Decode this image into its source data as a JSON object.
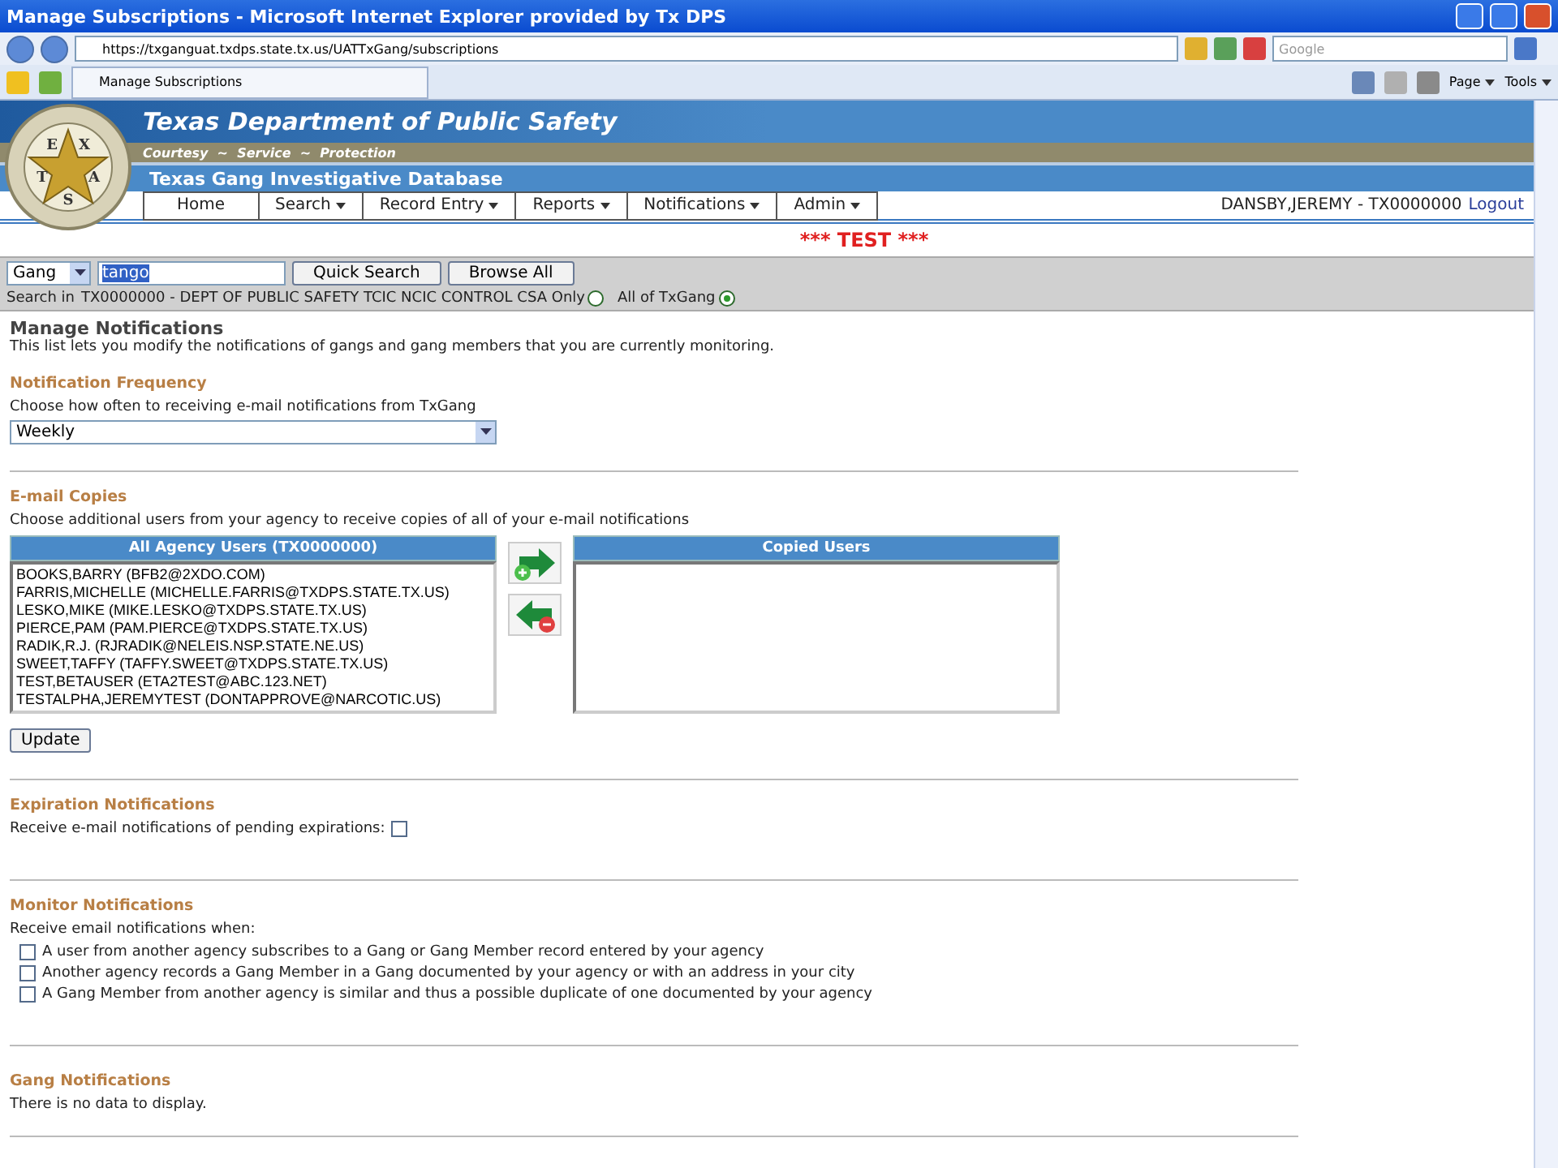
{
  "browser": {
    "title": "Manage Subscriptions - Microsoft Internet Explorer provided by Tx DPS",
    "address": "https://txganguat.txdps.state.tx.us/UATTxGang/subscriptions",
    "search_placeholder": "Google",
    "tab": "Manage Subscriptions",
    "tools": [
      "Page",
      "Tools"
    ]
  },
  "header": {
    "seal_letters": [
      "E",
      "X",
      "T",
      "A",
      "S"
    ],
    "title": "Texas Department of Public Safety",
    "motto": "Courtesy  ~  Service  ~  Protection",
    "subtitle": "Texas Gang Investigative Database",
    "nav": [
      {
        "label": "Home",
        "has_menu": false
      },
      {
        "label": "Search",
        "has_menu": true
      },
      {
        "label": "Record Entry",
        "has_menu": true
      },
      {
        "label": "Reports",
        "has_menu": true
      },
      {
        "label": "Notifications",
        "has_menu": true
      },
      {
        "label": "Admin",
        "has_menu": true
      }
    ],
    "user": "DANSBY,JEREMY - TX0000000",
    "logout": "Logout",
    "banner": "*** TEST ***"
  },
  "search": {
    "type": "Gang",
    "query": "tango",
    "buttons": [
      "Quick Search",
      "Browse All"
    ],
    "scope_label": "Search in",
    "scopes": [
      {
        "label": "TX0000000 - DEPT OF PUBLIC SAFETY TCIC NCIC CONTROL CSA Only",
        "selected": false
      },
      {
        "label": "All of TxGang",
        "selected": true
      }
    ]
  },
  "page": {
    "title": "Manage Notifications",
    "intro": "This list lets you modify the notifications of gangs and gang members that you are currently monitoring."
  },
  "frequency": {
    "title": "Notification Frequency",
    "label": "Choose how often to receiving e-mail notifications from TxGang",
    "value": "Weekly"
  },
  "copies": {
    "title": "E-mail Copies",
    "label": "Choose additional users from your agency to receive copies of all of your e-mail notifications",
    "all_header": "All Agency Users (TX0000000)",
    "copied_header": "Copied Users",
    "all_users": [
      "BOOKS,BARRY (BFB2@2XDO.COM)",
      "FARRIS,MICHELLE (MICHELLE.FARRIS@TXDPS.STATE.TX.US)",
      "LESKO,MIKE (MIKE.LESKO@TXDPS.STATE.TX.US)",
      "PIERCE,PAM (PAM.PIERCE@TXDPS.STATE.TX.US)",
      "RADIK,R.J. (RJRADIK@NELEIS.NSP.STATE.NE.US)",
      "SWEET,TAFFY (TAFFY.SWEET@TXDPS.STATE.TX.US)",
      "TEST,BETAUSER (ETA2TEST@ABC.123.NET)",
      "TESTALPHA,JEREMYTEST (DONTAPPROVE@NARCOTIC.US)"
    ],
    "update": "Update"
  },
  "expiration": {
    "title": "Expiration Notifications",
    "label": "Receive e-mail notifications of pending expirations:",
    "checked": false
  },
  "monitor": {
    "title": "Monitor Notifications",
    "label": "Receive email notifications when:",
    "options": [
      {
        "label": "A user from another agency subscribes to a Gang or Gang Member record entered by your agency",
        "checked": false
      },
      {
        "label": "Another agency records a Gang Member in a Gang documented by your agency or with an address in your city",
        "checked": false
      },
      {
        "label": "A Gang Member from another agency is similar and thus a possible duplicate of one documented by your agency",
        "checked": false
      }
    ]
  },
  "gang": {
    "title": "Gang Notifications",
    "empty": "There is no data to display."
  }
}
